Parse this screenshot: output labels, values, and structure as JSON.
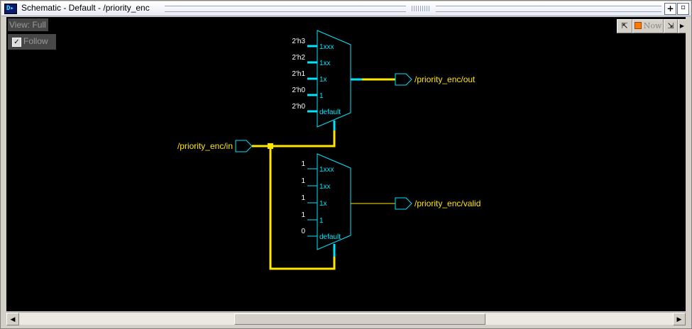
{
  "window": {
    "title": "Schematic - Default - /priority_enc"
  },
  "title_icon_glyph": "D▸",
  "titlebar_buttons": {
    "add": "+",
    "undock": "▫"
  },
  "view": {
    "mode_label": "View: Full",
    "follow_label": "Follow",
    "follow_checked": true
  },
  "toolbar": {
    "now_label": "Now"
  },
  "scrollbar": {
    "left_arrow": "◀",
    "right_arrow": "▶"
  },
  "colors": {
    "wire": "#ffe600",
    "component": "#00e6ff",
    "label": "#ffe600",
    "const": "#ffffff",
    "background": "#000000"
  },
  "schematic": {
    "mux_top": {
      "inputs": [
        {
          "const": "2'h3",
          "port": "1xxx"
        },
        {
          "const": "2'h2",
          "port": "1xx"
        },
        {
          "const": "2'h1",
          "port": "1x"
        },
        {
          "const": "2'h0",
          "port": "1"
        },
        {
          "const": "2'h0",
          "port": "default"
        }
      ],
      "output_label": "/priority_enc/out"
    },
    "mux_bottom": {
      "inputs": [
        {
          "const": "1",
          "port": "1xxx"
        },
        {
          "const": "1",
          "port": "1xx"
        },
        {
          "const": "1",
          "port": "1x"
        },
        {
          "const": "1",
          "port": "1"
        },
        {
          "const": "0",
          "port": "default"
        }
      ],
      "output_label": "/priority_enc/valid"
    },
    "input_label": "/priority_enc/in"
  }
}
